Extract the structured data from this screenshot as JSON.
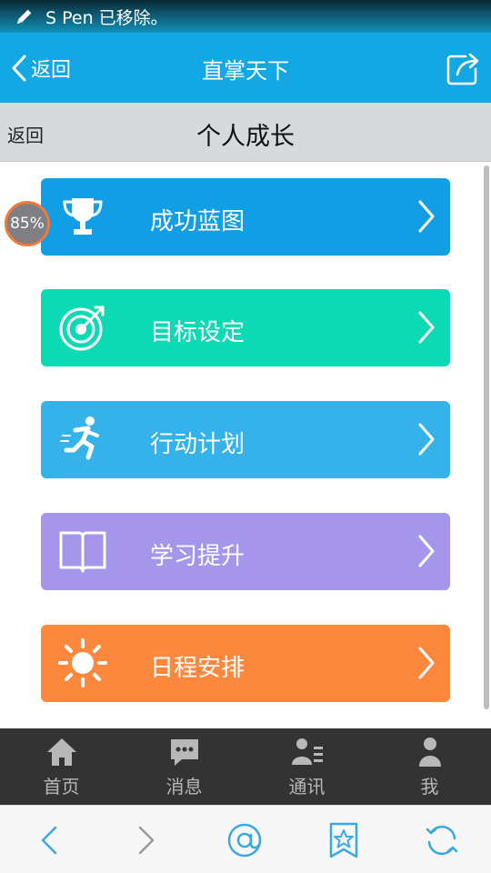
{
  "status_bar": {
    "message": "S Pen 已移除。",
    "icon": "pen-icon"
  },
  "nav": {
    "back_label": "返回",
    "title": "直掌天下",
    "share_icon": "share-icon"
  },
  "sub_header": {
    "back_label": "返回",
    "title": "个人成长"
  },
  "zoom_badge": "85%",
  "menu": [
    {
      "label": "成功蓝图",
      "icon": "trophy-icon",
      "color": "#129ee5"
    },
    {
      "label": "目标设定",
      "icon": "target-icon",
      "color": "#0bdab4"
    },
    {
      "label": "行动计划",
      "icon": "runner-icon",
      "color": "#36b2ea"
    },
    {
      "label": "学习提升",
      "icon": "book-icon",
      "color": "#a596eb"
    },
    {
      "label": "日程安排",
      "icon": "sun-icon",
      "color": "#fb883c"
    }
  ],
  "tabs": [
    {
      "label": "首页",
      "icon": "home-icon"
    },
    {
      "label": "消息",
      "icon": "message-icon"
    },
    {
      "label": "通讯",
      "icon": "contacts-icon"
    },
    {
      "label": "我",
      "icon": "person-icon"
    }
  ],
  "browser_controls": [
    "back-arrow-icon",
    "forward-arrow-icon",
    "at-icon",
    "bookmark-star-icon",
    "refresh-icon"
  ],
  "colors": {
    "nav_blue": "#13a8e3",
    "sub_bar_gray": "#d7dadd",
    "tab_bar_dark": "#333333",
    "badge_ring": "#f07a3a"
  }
}
